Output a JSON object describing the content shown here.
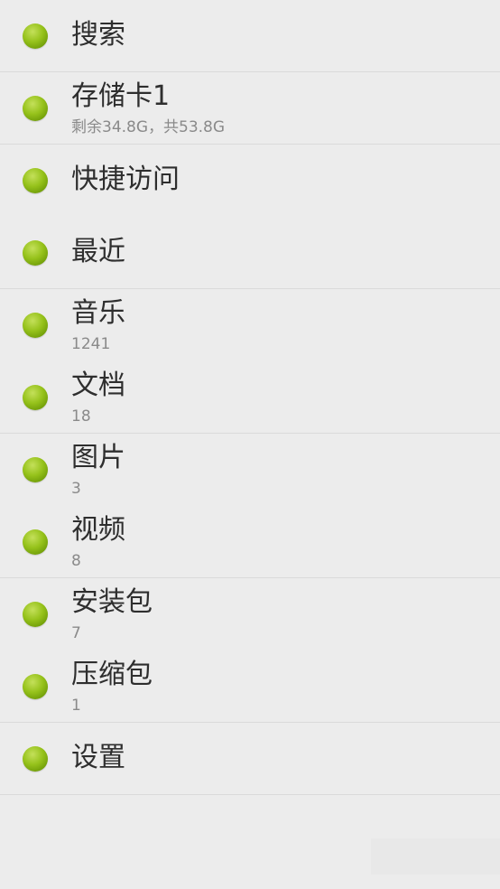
{
  "menu": {
    "items": [
      {
        "label": "搜索"
      },
      {
        "label": "存储卡1",
        "sub": "剩余34.8G，共53.8G"
      },
      {
        "label": "快捷访问"
      },
      {
        "label": "最近"
      },
      {
        "label": "音乐",
        "sub": "1241"
      },
      {
        "label": "文档",
        "sub": "18"
      },
      {
        "label": "图片",
        "sub": "3"
      },
      {
        "label": "视频",
        "sub": "8"
      },
      {
        "label": "安装包",
        "sub": "7"
      },
      {
        "label": "压缩包",
        "sub": "1"
      },
      {
        "label": "设置"
      }
    ]
  },
  "colors": {
    "background": "#ececec",
    "divider": "#dadada",
    "dot_green": "#96c21b",
    "label_text": "#2e2e2e",
    "sub_text": "#8a8a8a"
  },
  "icons": {
    "item_marker": "green-dot-icon"
  }
}
